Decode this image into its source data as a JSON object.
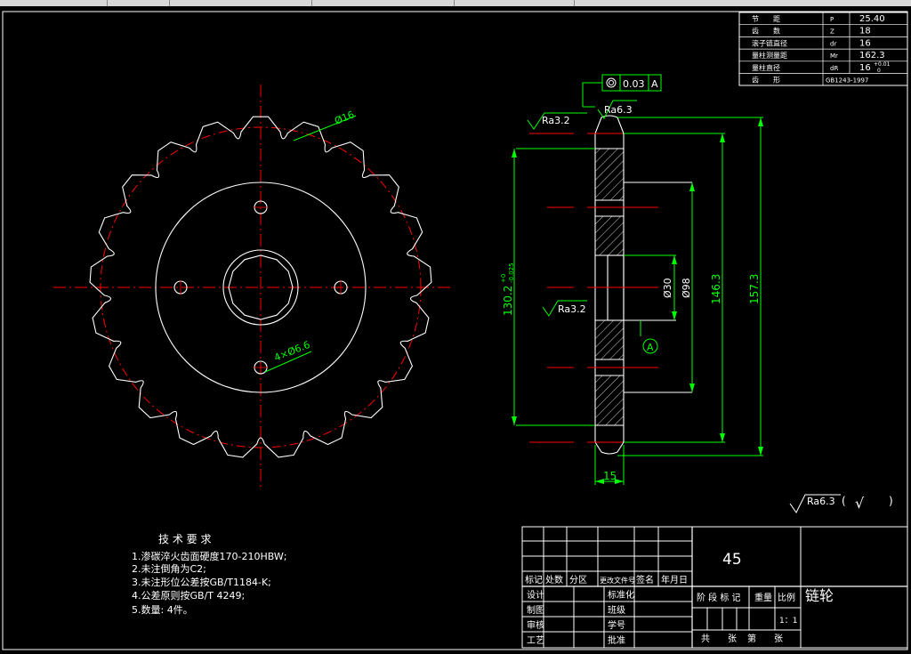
{
  "params_table": {
    "rows": [
      {
        "name": "节　　距",
        "symbol": "P",
        "value": "25.40"
      },
      {
        "name": "齿　　数",
        "symbol": "Z",
        "value": "18"
      },
      {
        "name": "滚子链直径",
        "symbol": "dr",
        "value": "16"
      },
      {
        "name": "量柱测量距",
        "symbol": "Mr",
        "value": "162.3"
      },
      {
        "name": "量柱直径",
        "symbol": "dR",
        "value": "16",
        "tol_upper": "+0.01",
        "tol_lower": "0"
      },
      {
        "name": "齿　　形",
        "symbol": "GB1243-1997",
        "value": ""
      }
    ]
  },
  "front_view": {
    "roller_dim": "Ø16",
    "hole_dim": "4×Ø6.6"
  },
  "section_view": {
    "tolerance_flatness": "0.03",
    "datum": "A",
    "roughness_top_left": "Ra3.2",
    "roughness_top": "Ra6.3",
    "roughness_hub": "Ra3.2",
    "dim_hub_dia": "130.2",
    "dim_hub_tol_upper": "+0",
    "dim_hub_tol_lower": "-0.025",
    "dim_bore": "Ø30",
    "dim_boss": "Ø98",
    "dim_root": "146.3",
    "dim_tip": "157.3",
    "dim_width": "15",
    "datum_label": "A"
  },
  "general_roughness": {
    "value": "Ra6.3",
    "paren_open": "(",
    "check": "√",
    "paren_close": ")"
  },
  "tech_requirements": {
    "title": "技 术 要 求",
    "items": [
      "1.渗碳淬火齿面硬度170-210HBW;",
      "2.未注倒角为C2;",
      "3.未注形位公差按GB/T1184-K;",
      "4.公差原则按GB/T 4249;",
      "5.数量: 4件。"
    ]
  },
  "title_block": {
    "material": "45",
    "part_name": "链轮",
    "scale": "1：1",
    "rev_headers": [
      "标记",
      "处数",
      "分区",
      "更改文件号",
      "签名",
      "年月日"
    ],
    "row_labels": [
      "设计",
      "制图",
      "审核",
      "工艺"
    ],
    "mid_labels": [
      "标准化",
      "班级",
      "学号",
      "批准"
    ],
    "stage_headers": [
      "阶 段 标 记",
      "重量",
      "比例"
    ],
    "bottom": [
      "共",
      "张",
      "第",
      "张"
    ]
  },
  "colors": {
    "drawing": "#ffffff",
    "dimension": "#00ff00",
    "centerline": "#ff0000"
  }
}
